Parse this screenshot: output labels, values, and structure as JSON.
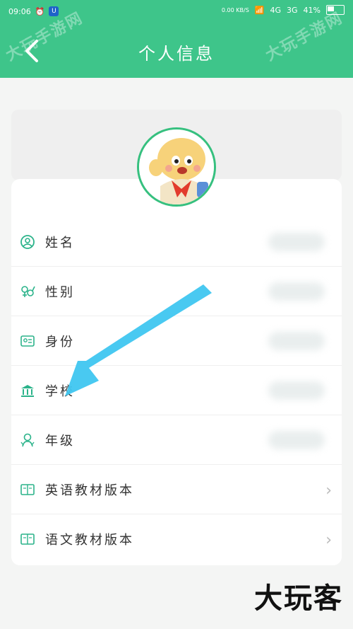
{
  "status": {
    "time": "09:06",
    "speed": "0.00\nKB/S",
    "net4g": "4G",
    "net3g": "3G",
    "battery": "41%"
  },
  "header": {
    "title": "个人信息"
  },
  "watermark": {
    "text": "大玩手游网"
  },
  "rows": [
    {
      "label": "姓名",
      "icon": "person-icon"
    },
    {
      "label": "性别",
      "icon": "gender-icon"
    },
    {
      "label": "身份",
      "icon": "id-card-icon"
    },
    {
      "label": "学校",
      "icon": "school-icon"
    },
    {
      "label": "年级",
      "icon": "grade-icon"
    },
    {
      "label": "英语教材版本",
      "icon": "book-icon"
    },
    {
      "label": "语文教材版本",
      "icon": "book-icon"
    }
  ],
  "brand": {
    "text": "大玩客"
  },
  "colors": {
    "accent": "#3ec58a",
    "arrow": "#3fc6f0"
  }
}
